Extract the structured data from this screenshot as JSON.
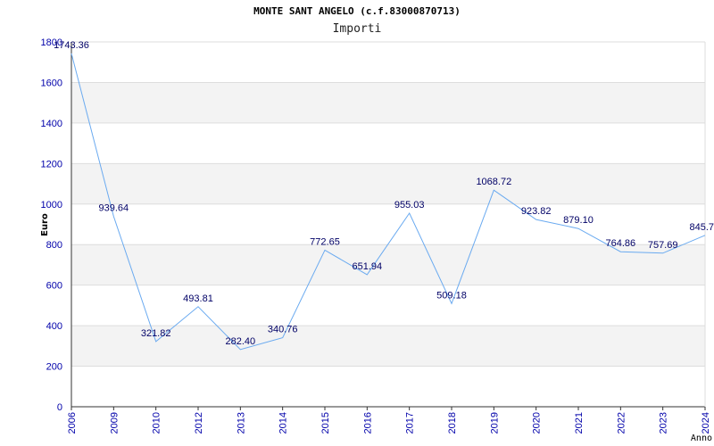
{
  "chart_data": {
    "type": "line",
    "title": "MONTE SANT ANGELO (c.f.83000870713)",
    "subtitle": "Importi",
    "xlabel": "Anno",
    "ylabel": "Euro",
    "categories": [
      "2006",
      "2009",
      "2010",
      "2012",
      "2013",
      "2014",
      "2015",
      "2016",
      "2017",
      "2018",
      "2019",
      "2020",
      "2021",
      "2022",
      "2023",
      "2024"
    ],
    "values": [
      1743.36,
      939.64,
      321.82,
      493.81,
      282.4,
      340.76,
      772.65,
      651.94,
      955.03,
      509.18,
      1068.72,
      923.82,
      879.1,
      764.86,
      757.69,
      845.7
    ],
    "value_labels": [
      "1743.36",
      "939.64",
      "321.82",
      "493.81",
      "282.40",
      "340.76",
      "772.65",
      "651.94",
      "955.03",
      "509.18",
      "1068.72",
      "923.82",
      "879.10",
      "764.86",
      "757.69",
      "845.7"
    ],
    "ylim": [
      0,
      1800
    ],
    "yticks": [
      0,
      200,
      400,
      600,
      800,
      1000,
      1200,
      1400,
      1600,
      1800
    ],
    "grid": true,
    "colors": {
      "line": "#6aaaf0",
      "band": "#f3f3f3",
      "grid": "#dddddd",
      "axis": "#333333",
      "tick_text": "#0000aa",
      "label_text": "#000066"
    }
  }
}
